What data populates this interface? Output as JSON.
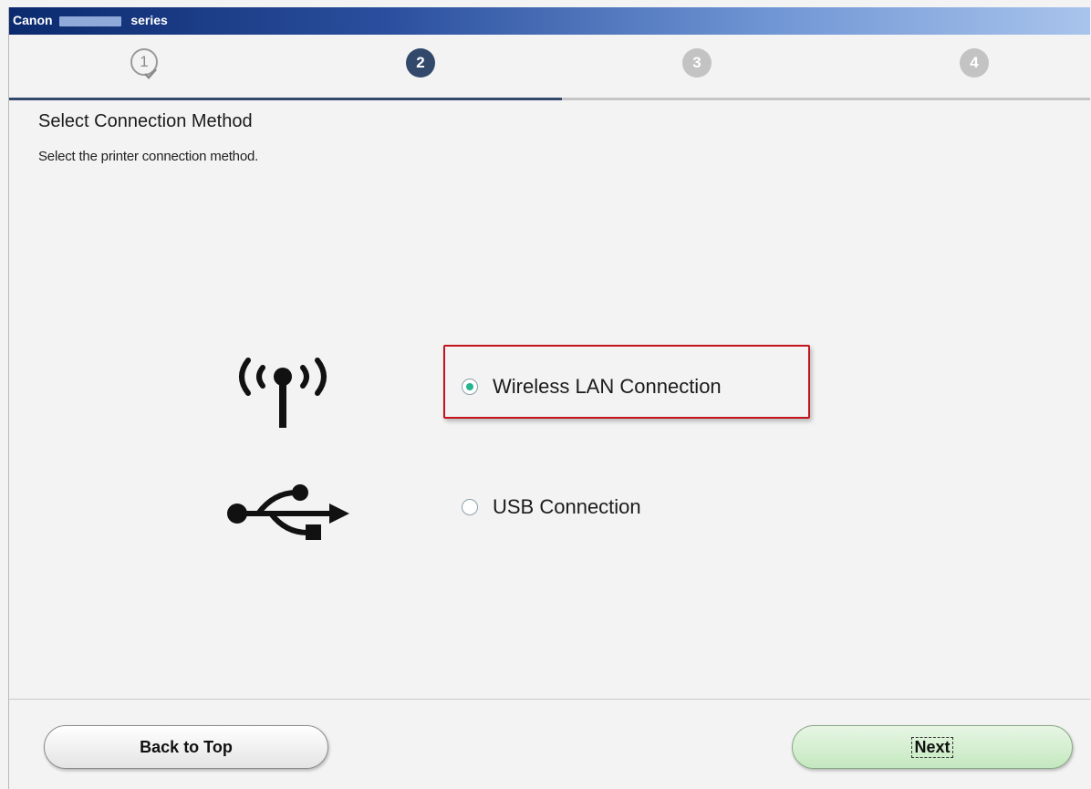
{
  "titlebar": {
    "brand": "Canon",
    "suffix": "series"
  },
  "steps": [
    {
      "number": "1",
      "state": "done"
    },
    {
      "number": "2",
      "state": "active"
    },
    {
      "number": "3",
      "state": "todo"
    },
    {
      "number": "4",
      "state": "todo"
    }
  ],
  "page": {
    "heading": "Select Connection Method",
    "subheading": "Select the printer connection method."
  },
  "options": [
    {
      "label": "Wireless LAN Connection",
      "icon": "wireless-icon",
      "selected": true
    },
    {
      "label": "USB Connection",
      "icon": "usb-icon",
      "selected": false
    }
  ],
  "footer": {
    "back_label": "Back to Top",
    "next_label": "Next"
  },
  "colors": {
    "accent": "#33496c",
    "radio_selected": "#26b58f",
    "highlight": "#c4131c",
    "next_button": "#c4e8bf"
  }
}
